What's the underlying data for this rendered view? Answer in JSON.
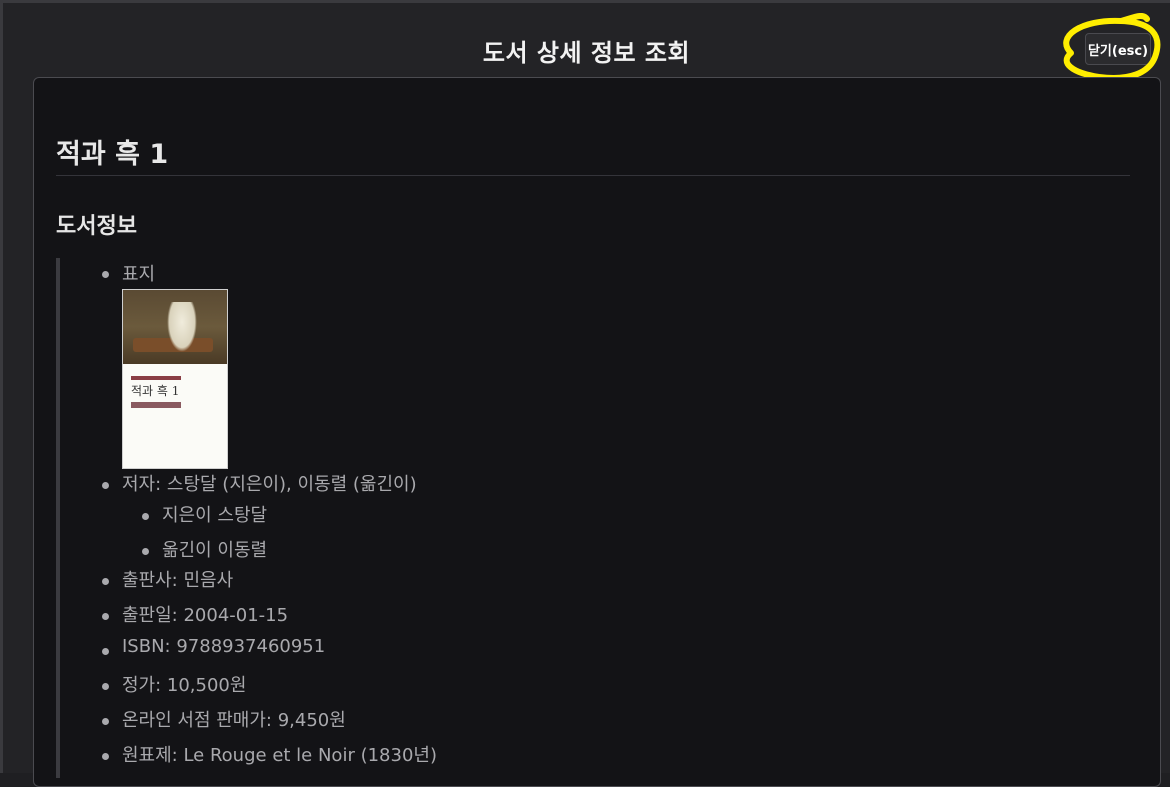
{
  "modal": {
    "title": "도서 상세 정보 조회",
    "close_label": "닫기(esc)"
  },
  "highlight_color": "#ffee00",
  "book": {
    "title": "적과 흑 1",
    "section_heading": "도서정보",
    "cover_label": "표지",
    "cover_text": "적과 흑 1",
    "author_line": "저자: 스탕달 (지은이), 이동렬 (옮긴이)",
    "contributors": [
      "지은이 스탕달",
      "옮긴이 이동렬"
    ],
    "publisher_line": "출판사: 민음사",
    "pub_date_line": "출판일: 2004-01-15",
    "isbn_line": "ISBN: 9788937460951",
    "price_line": "정가: 10,500원",
    "sale_price_line": "온라인 서점 판매가: 9,450원",
    "original_title_line": "원표제: Le Rouge et le Noir (1830년)"
  },
  "colors": {
    "background": "#131316",
    "text": "#a9a9ad",
    "heading": "#e8e8e8",
    "cover_accent": "#8a3e45"
  }
}
